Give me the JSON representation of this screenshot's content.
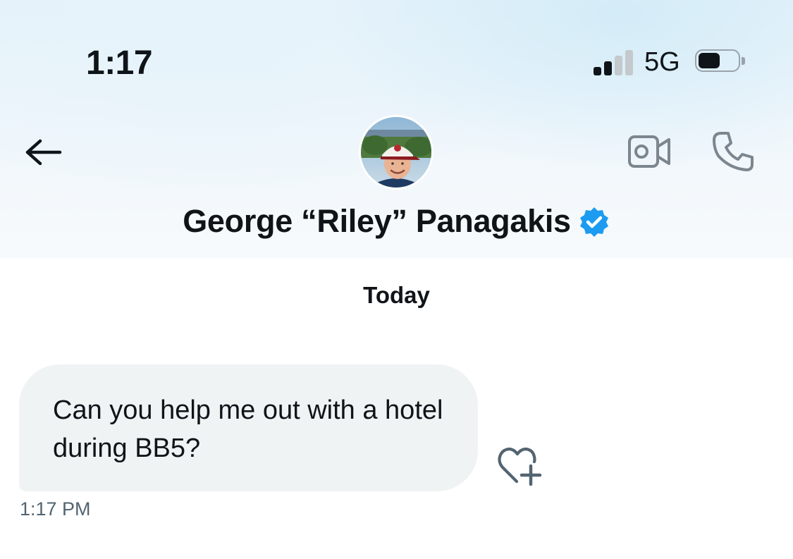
{
  "status_bar": {
    "time": "1:17",
    "network": "5G",
    "signal_bars_filled": 2,
    "signal_bars_total": 4,
    "battery_level": 0.55
  },
  "header": {
    "back_icon": "arrow-left-icon",
    "avatar_icon": "profile-photo",
    "contact_name": "George “Riley” Panagakis",
    "verified_icon": "verified-badge-icon",
    "video_icon": "video-camera-icon",
    "call_icon": "phone-icon"
  },
  "conversation": {
    "date_divider": "Today",
    "messages": [
      {
        "text": "Can you help me out with a hotel during BB5?",
        "timestamp": "1:17 PM",
        "reaction_icon": "heart-plus-icon"
      }
    ]
  },
  "colors": {
    "text_primary": "#0f1419",
    "text_secondary": "#536471",
    "bubble_bg": "#eff3f4",
    "verified_blue": "#1d9bf0",
    "icon_gray": "#7c868e"
  }
}
